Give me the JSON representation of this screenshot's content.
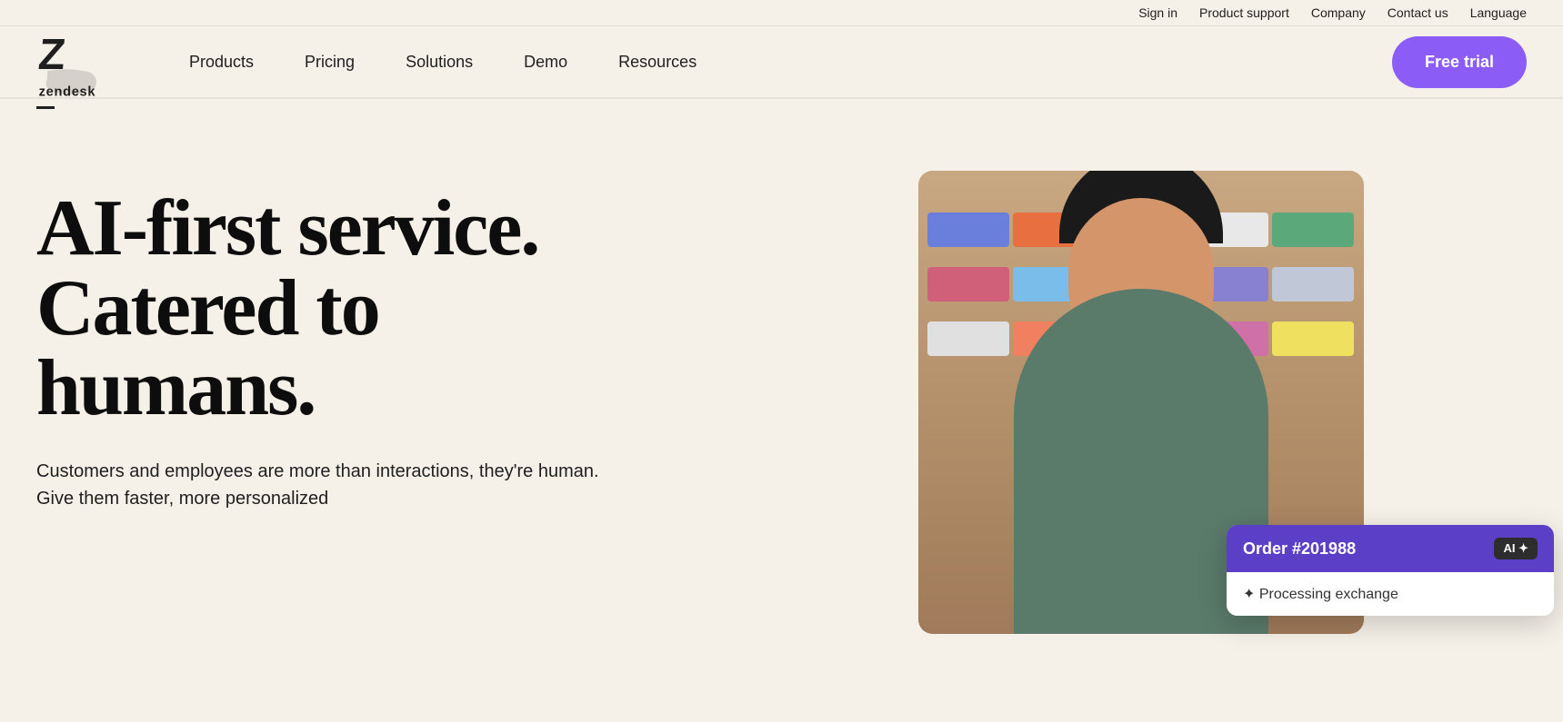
{
  "topbar": {
    "links": [
      {
        "id": "sign-in",
        "label": "Sign in"
      },
      {
        "id": "product-support",
        "label": "Product support"
      },
      {
        "id": "company",
        "label": "Company"
      },
      {
        "id": "contact-us",
        "label": "Contact us"
      },
      {
        "id": "language",
        "label": "Language"
      }
    ]
  },
  "logo": {
    "alt": "Zendesk",
    "text": "zendesk"
  },
  "nav": {
    "items": [
      {
        "id": "products",
        "label": "Products"
      },
      {
        "id": "pricing",
        "label": "Pricing"
      },
      {
        "id": "solutions",
        "label": "Solutions"
      },
      {
        "id": "demo",
        "label": "Demo"
      },
      {
        "id": "resources",
        "label": "Resources"
      }
    ],
    "cta": "Free trial"
  },
  "hero": {
    "headline_line1": "AI-first service.",
    "headline_line2": "Catered to",
    "headline_line3": "humans.",
    "subtext": "Customers and employees are more than interactions, they're human. Give them faster, more personalized",
    "image_alt": "Person in shoe store smiling"
  },
  "ai_card": {
    "order_label": "Order #201988",
    "badge_label": "AI ✦",
    "processing_label": "✦ Processing exchange"
  }
}
